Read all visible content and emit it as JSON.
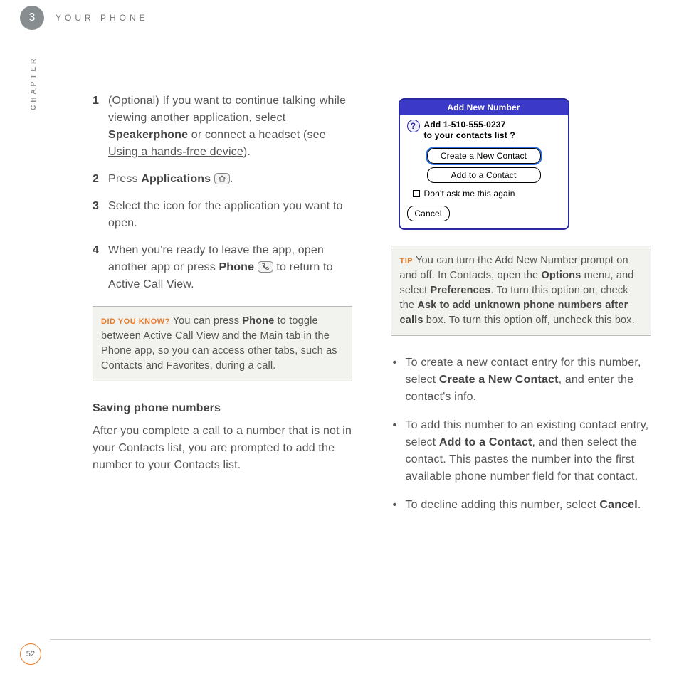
{
  "header": {
    "chapter_number": "3",
    "running_head": "YOUR PHONE",
    "side_label": "CHAPTER"
  },
  "page_number": "52",
  "left": {
    "steps": [
      {
        "num": "1",
        "prefix": "(Optional)  If you want to continue talking while viewing another application, select ",
        "bold1": "Speakerphone",
        "mid": " or connect a headset (see ",
        "underline": "Using a hands-free device",
        "suffix": ")."
      },
      {
        "num": "2",
        "prefix": "Press ",
        "bold1": "Applications",
        "mid": " ",
        "suffix": "."
      },
      {
        "num": "3",
        "text": "Select the icon for the application you want to open."
      },
      {
        "num": "4",
        "prefix": "When you're ready to leave the app, open another app or press ",
        "bold1": "Phone",
        "mid": " ",
        "suffix": " to return to Active Call View."
      }
    ],
    "didyouknow": {
      "lead": "DID YOU KNOW?",
      "pre": "  You can press ",
      "bold": "Phone",
      "post": " to toggle between Active Call View and the Main tab in the Phone app, so you can access other tabs, such as Contacts and Favorites, during a call."
    },
    "subhead": "Saving phone numbers",
    "para": "After you complete a call to a number that is not in your Contacts list, you are prompted to add the number to your Contacts list."
  },
  "dialog": {
    "title": "Add New Number",
    "line1": "Add 1-510-555-0237",
    "line2": "to your contacts list ?",
    "btn_create": "Create a New Contact",
    "btn_add": "Add to a Contact",
    "check": "Don't ask me this again",
    "btn_cancel": "Cancel"
  },
  "tip": {
    "lead": "TIP",
    "t1": "  You can turn the Add New Number prompt on and off. In Contacts, open the ",
    "b1": "Options",
    "t2": " menu, and select ",
    "b2": "Preferences",
    "t3": ". To turn this option on, check the ",
    "b3": "Ask to add unknown phone numbers after calls",
    "t4": " box. To turn this option off, uncheck this box."
  },
  "bullets": {
    "i1": {
      "a": "To create a new contact entry for this number, select ",
      "b": "Create a New Contact",
      "c": ", and enter the contact's info."
    },
    "i2": {
      "a": "To add this number to an existing contact entry, select ",
      "b": "Add to a Contact",
      "c": ", and then select the contact. This pastes the number into the first available phone number field for that contact."
    },
    "i3": {
      "a": "To decline adding this number, select ",
      "b": "Cancel",
      "c": "."
    }
  }
}
